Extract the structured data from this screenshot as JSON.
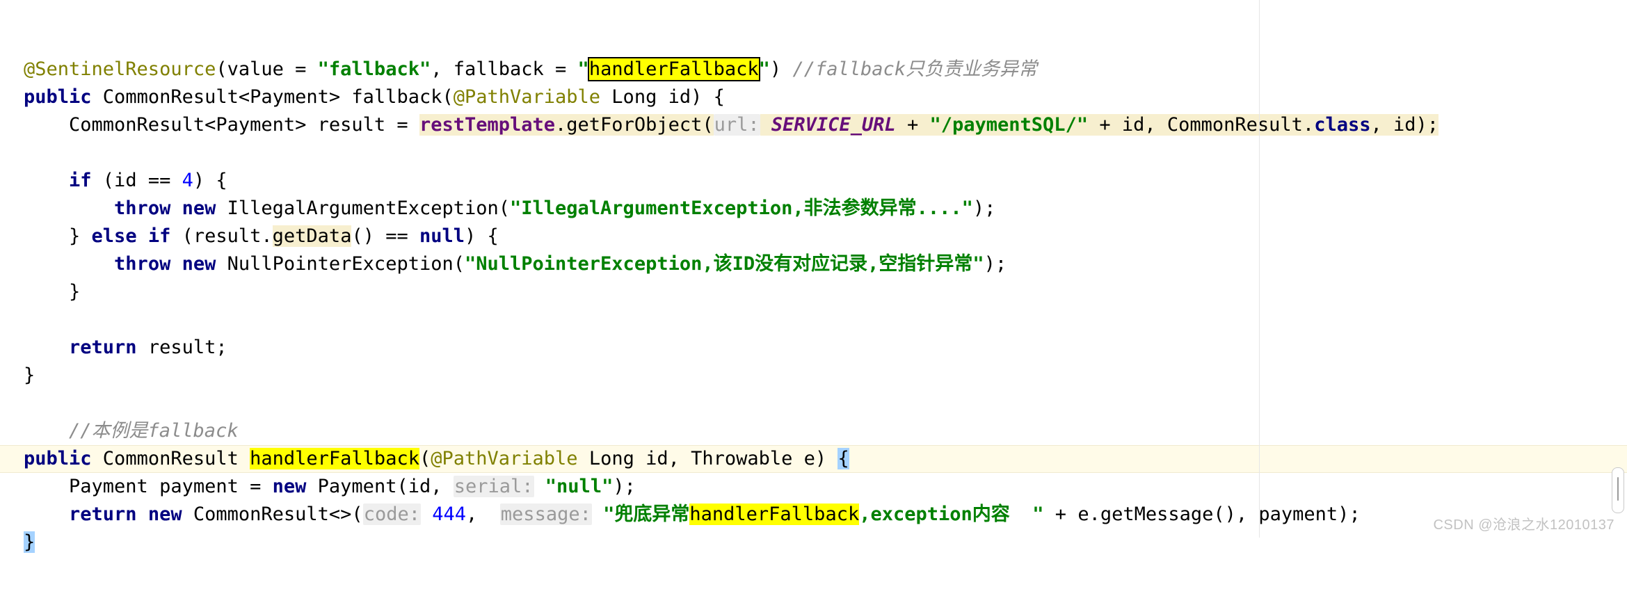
{
  "editor": {
    "language": "java",
    "font_size_px": 27,
    "colors": {
      "background": "#ffffff",
      "keyword": "#000080",
      "string": "#008000",
      "number": "#0000ff",
      "comment": "#8c8c8c",
      "annotation": "#808000",
      "field": "#660e7a",
      "identifier_highlight": "#f7efcf",
      "search_match": "#ffff00",
      "brace_match": "#a5d2ff",
      "param_hint_bg": "#efefef",
      "param_hint_fg": "#9a9a9a",
      "caret_row": "#fffbe8",
      "margin_guide": "#e6e6e6",
      "watermark": "#c2c2c2"
    },
    "lines": [
      {
        "id": "line-annotation",
        "tokens": [
          {
            "t": "@SentinelResource",
            "c": "anno"
          },
          {
            "t": "(value = ",
            "c": "plain"
          },
          {
            "t": "\"fallback\"",
            "c": "str"
          },
          {
            "t": ", fallback = ",
            "c": "plain"
          },
          {
            "t": "\"",
            "c": "str"
          },
          {
            "t": "handlerFallback",
            "c": "hl-find-box"
          },
          {
            "t": "\"",
            "c": "str"
          },
          {
            "t": ") ",
            "c": "plain"
          },
          {
            "t": "//fallback只负责业务异常",
            "c": "cmt"
          }
        ]
      },
      {
        "id": "line-fallback-signature",
        "tokens": [
          {
            "t": "public",
            "c": "kw"
          },
          {
            "t": " CommonResult<Payment> fallback(",
            "c": "plain"
          },
          {
            "t": "@PathVariable",
            "c": "anno"
          },
          {
            "t": " Long id) {",
            "c": "plain"
          }
        ]
      },
      {
        "id": "line-resttemplate-call",
        "tokens": [
          {
            "t": "    CommonResult<Payment> result = ",
            "c": "plain"
          },
          {
            "t": "restTemplate",
            "c": "inst hl-ident"
          },
          {
            "t": ".getForObject(",
            "c": "plain hl-ident"
          },
          {
            "t": "url:",
            "c": "hint"
          },
          {
            "t": " ",
            "c": "plain hl-ident"
          },
          {
            "t": "SERVICE_URL",
            "c": "field hl-ident"
          },
          {
            "t": " + ",
            "c": "plain hl-ident"
          },
          {
            "t": "\"/paymentSQL/\"",
            "c": "str hl-ident"
          },
          {
            "t": " + id, CommonResult.",
            "c": "plain hl-ident"
          },
          {
            "t": "class",
            "c": "kw hl-ident"
          },
          {
            "t": ", id);",
            "c": "plain hl-ident"
          }
        ]
      },
      {
        "id": "line-blank-1",
        "tokens": []
      },
      {
        "id": "line-if-id-4",
        "tokens": [
          {
            "t": "    ",
            "c": "plain"
          },
          {
            "t": "if",
            "c": "kw"
          },
          {
            "t": " (id == ",
            "c": "plain"
          },
          {
            "t": "4",
            "c": "num"
          },
          {
            "t": ") {",
            "c": "plain"
          }
        ]
      },
      {
        "id": "line-throw-illegalargument",
        "tokens": [
          {
            "t": "        ",
            "c": "plain"
          },
          {
            "t": "throw new",
            "c": "kw"
          },
          {
            "t": " IllegalArgumentException(",
            "c": "plain"
          },
          {
            "t": "\"IllegalArgumentException,非法参数异常....\"",
            "c": "str"
          },
          {
            "t": ");",
            "c": "plain"
          }
        ]
      },
      {
        "id": "line-else-if-getdata-null",
        "tokens": [
          {
            "t": "    } ",
            "c": "plain"
          },
          {
            "t": "else if",
            "c": "kw"
          },
          {
            "t": " (result.",
            "c": "plain"
          },
          {
            "t": "getData",
            "c": "plain hl-ident"
          },
          {
            "t": "() == ",
            "c": "plain"
          },
          {
            "t": "null",
            "c": "kw"
          },
          {
            "t": ") {",
            "c": "plain"
          }
        ]
      },
      {
        "id": "line-throw-nullpointer",
        "tokens": [
          {
            "t": "        ",
            "c": "plain"
          },
          {
            "t": "throw new",
            "c": "kw"
          },
          {
            "t": " NullPointerException(",
            "c": "plain"
          },
          {
            "t": "\"NullPointerException,该ID没有对应记录,空指针异常\"",
            "c": "str"
          },
          {
            "t": ");",
            "c": "plain"
          }
        ]
      },
      {
        "id": "line-close-else-brace",
        "tokens": [
          {
            "t": "    }",
            "c": "plain"
          }
        ]
      },
      {
        "id": "line-blank-2",
        "tokens": []
      },
      {
        "id": "line-return-result",
        "tokens": [
          {
            "t": "    ",
            "c": "plain"
          },
          {
            "t": "return",
            "c": "kw"
          },
          {
            "t": " result;",
            "c": "plain"
          }
        ]
      },
      {
        "id": "line-close-method-brace",
        "tokens": [
          {
            "t": "}",
            "c": "plain"
          }
        ]
      },
      {
        "id": "line-blank-3",
        "tokens": []
      },
      {
        "id": "line-comment-fallback",
        "tokens": [
          {
            "t": "    //本例是fallback",
            "c": "cmt"
          }
        ]
      },
      {
        "id": "line-handlerfallback-signature",
        "caret": true,
        "tokens": [
          {
            "t": "public",
            "c": "kw"
          },
          {
            "t": " CommonResult ",
            "c": "plain"
          },
          {
            "t": "handlerFallback",
            "c": "hl-find"
          },
          {
            "t": "(",
            "c": "plain"
          },
          {
            "t": "@PathVariable",
            "c": "anno"
          },
          {
            "t": " Long id, Throwable e) ",
            "c": "plain"
          },
          {
            "t": "{",
            "c": "plain hl-brace"
          }
        ]
      },
      {
        "id": "line-new-payment",
        "tokens": [
          {
            "t": "    Payment payment = ",
            "c": "plain"
          },
          {
            "t": "new",
            "c": "kw"
          },
          {
            "t": " Payment(id, ",
            "c": "plain"
          },
          {
            "t": "serial:",
            "c": "hint"
          },
          {
            "t": " ",
            "c": "plain"
          },
          {
            "t": "\"null\"",
            "c": "str"
          },
          {
            "t": ");",
            "c": "plain"
          }
        ]
      },
      {
        "id": "line-return-commonresult",
        "tokens": [
          {
            "t": "    ",
            "c": "plain"
          },
          {
            "t": "return new",
            "c": "kw"
          },
          {
            "t": " CommonResult<>(",
            "c": "plain"
          },
          {
            "t": "code:",
            "c": "hint"
          },
          {
            "t": " ",
            "c": "plain"
          },
          {
            "t": "444",
            "c": "num"
          },
          {
            "t": ",  ",
            "c": "plain"
          },
          {
            "t": "message:",
            "c": "hint"
          },
          {
            "t": " ",
            "c": "plain"
          },
          {
            "t": "\"兜底异常",
            "c": "str"
          },
          {
            "t": "handlerFallback",
            "c": "hl-find"
          },
          {
            "t": ",exception内容  \"",
            "c": "str"
          },
          {
            "t": " + e.getMessage(), payment);",
            "c": "plain"
          }
        ]
      },
      {
        "id": "line-final-brace",
        "tokens": [
          {
            "t": "}",
            "c": "plain hl-brace"
          }
        ]
      }
    ]
  },
  "watermark": {
    "text": "CSDN @沧浪之水12010137"
  },
  "scrollbar": {
    "position": "right",
    "thumb_label": "vertical-scroll-thumb"
  }
}
